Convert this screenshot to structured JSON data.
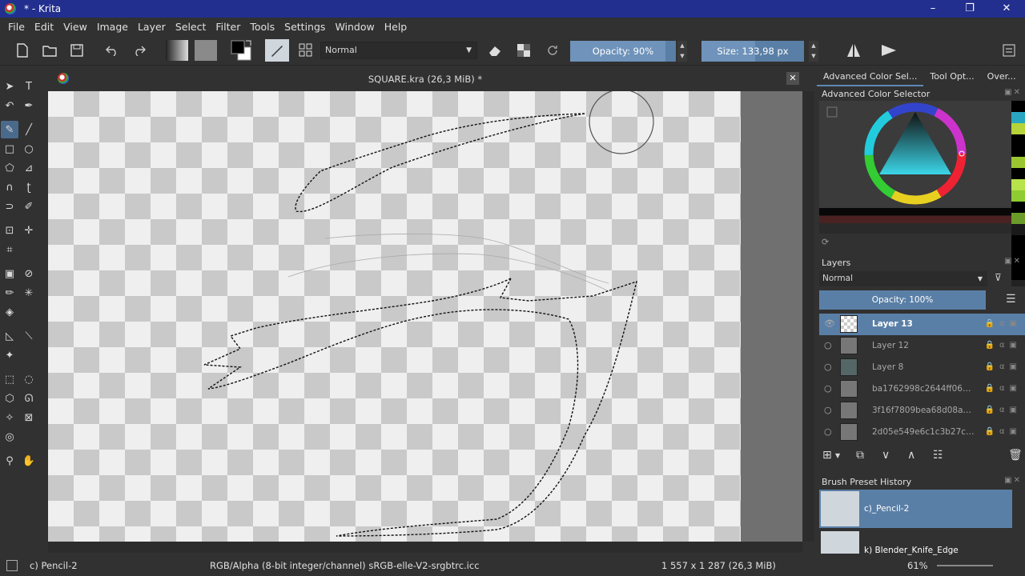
{
  "window": {
    "title": "* - Krita",
    "controls": [
      "–",
      "❐",
      "✕"
    ]
  },
  "menu": [
    "File",
    "Edit",
    "View",
    "Image",
    "Layer",
    "Select",
    "Filter",
    "Tools",
    "Settings",
    "Window",
    "Help"
  ],
  "toolbar": {
    "blend_mode": "Normal",
    "opacity_label": "Opacity: 90%",
    "opacity_value": 0.9,
    "size_label": "Size: 133,98 px"
  },
  "document": {
    "title": "SQUARE.kra (26,3 MiB) *",
    "close": "✕"
  },
  "panel": {
    "tabs": [
      "Advanced Color Sel...",
      "Tool Opt...",
      "Over..."
    ],
    "color_selector_title": "Advanced Color Selector",
    "layers_title": "Layers",
    "layers_blend": "Normal",
    "layers_opacity": "Opacity:  100%",
    "layers": [
      {
        "name": "Layer 13",
        "selected": true,
        "visible": true
      },
      {
        "name": "Layer 12",
        "selected": false,
        "visible": false
      },
      {
        "name": "Layer 8",
        "selected": false,
        "visible": false
      },
      {
        "name": "ba1762998c2644ff06b7d5f1...",
        "selected": false,
        "visible": false
      },
      {
        "name": "3f16f7809bea68d08a199a78...",
        "selected": false,
        "visible": false
      },
      {
        "name": "2d05e549e6c1c3b27c66d0b...",
        "selected": false,
        "visible": false
      }
    ],
    "brush_history_title": "Brush Preset History",
    "presets": [
      "c)_Pencil-2",
      "k) Blender_Knife_Edge"
    ]
  },
  "status": {
    "brush": "c) Pencil-2",
    "color_space": "RGB/Alpha (8-bit integer/channel)  sRGB-elle-V2-srgbtrc.icc",
    "dimensions": "1 557 x 1 287 (26,3 MiB)",
    "zoom": "61%"
  },
  "colors": {
    "accent": "#5a7fa6",
    "titlebar": "#232f8e",
    "background": "#313131"
  }
}
